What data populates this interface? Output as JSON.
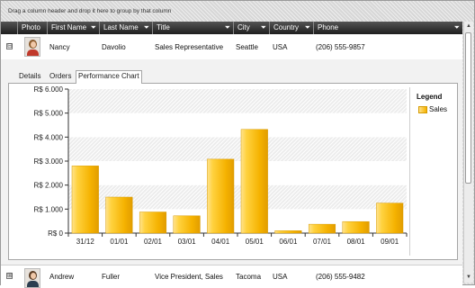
{
  "group_panel": {
    "hint": "Drag a column header and drop it here to group by that column"
  },
  "columns": [
    {
      "label": "Photo",
      "filter": false
    },
    {
      "label": "First Name",
      "filter": true
    },
    {
      "label": "Last Name",
      "filter": true
    },
    {
      "label": "Title",
      "filter": true
    },
    {
      "label": "City",
      "filter": true
    },
    {
      "label": "Country",
      "filter": true
    },
    {
      "label": "Phone",
      "filter": true
    }
  ],
  "filter_icon": "funnel-icon",
  "rows": [
    {
      "first_name": "Nancy",
      "last_name": "Davolio",
      "title": "Sales Representative",
      "city": "Seattle",
      "country": "USA",
      "phone": "(206) 555-9857",
      "expanded": true,
      "expander": "⊟"
    },
    {
      "first_name": "Andrew",
      "last_name": "Fuller",
      "title": "Vice President, Sales",
      "city": "Tacoma",
      "country": "USA",
      "phone": "(206) 555-9482",
      "expanded": false,
      "expander": "⊞"
    }
  ],
  "detail_tabs": [
    {
      "label": "Details",
      "active": false
    },
    {
      "label": "Orders",
      "active": false
    },
    {
      "label": "Performance Chart",
      "active": true
    }
  ],
  "chart_data": {
    "type": "bar",
    "categories": [
      "31/12",
      "01/01",
      "02/01",
      "03/01",
      "04/01",
      "05/01",
      "06/01",
      "07/01",
      "08/01",
      "09/01"
    ],
    "series": [
      {
        "name": "Sales",
        "values": [
          2800,
          1500,
          880,
          720,
          3080,
          4320,
          100,
          370,
          480,
          1250
        ]
      }
    ],
    "yticks": [
      "R$ 0",
      "R$ 1.000",
      "R$ 2.000",
      "R$ 3.000",
      "R$ 4.000",
      "R$ 5.000",
      "R$ 6.000"
    ],
    "ylim": [
      0,
      6000
    ],
    "grid": true,
    "legend_title": "Legend",
    "legend_position": "right",
    "color": "#f5b200"
  },
  "scrollbar": {
    "up": "▲",
    "down": "▼"
  }
}
